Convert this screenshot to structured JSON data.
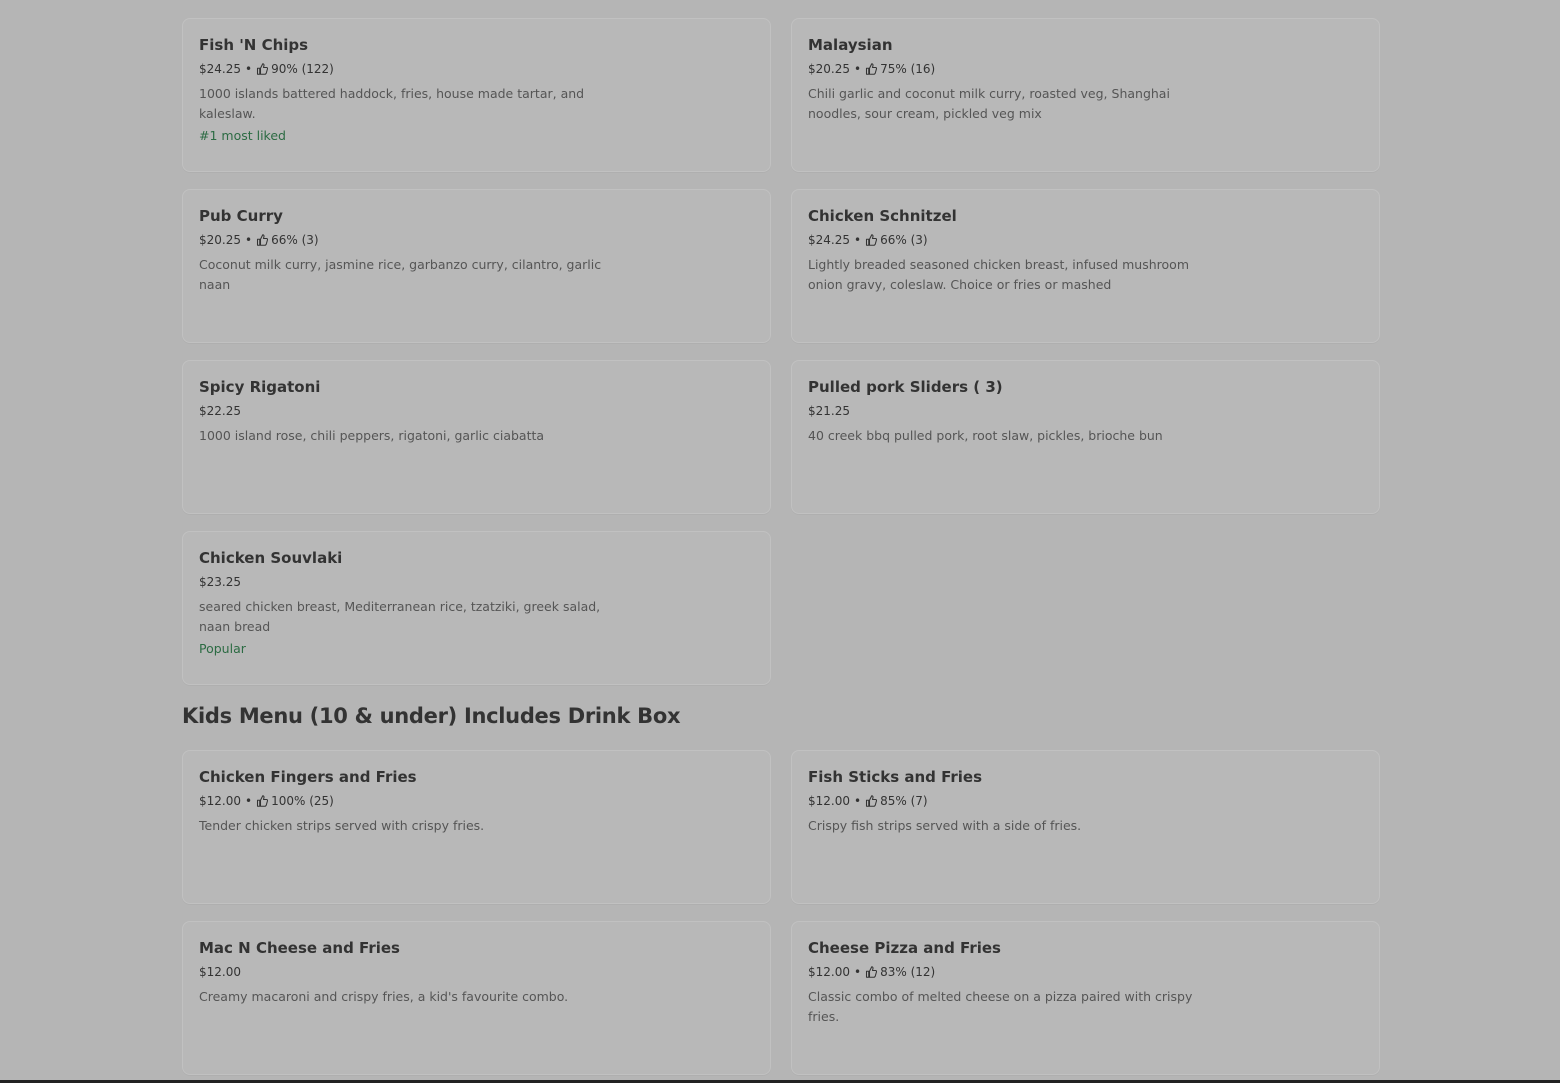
{
  "main_items": [
    {
      "name": "Fish 'N Chips",
      "price": "$24.25",
      "rating": "90% (122)",
      "description": "1000 islands battered haddock, fries, house made tartar, and kaleslaw.",
      "tag": "#1 most liked"
    },
    {
      "name": "Malaysian",
      "price": "$20.25",
      "rating": "75% (16)",
      "description": "Chili garlic and coconut milk curry, roasted veg, Shanghai noodles, sour cream, pickled veg mix",
      "tag": ""
    },
    {
      "name": "Pub Curry",
      "price": "$20.25",
      "rating": "66% (3)",
      "description": "Coconut milk curry, jasmine rice, garbanzo curry, cilantro, garlic naan",
      "tag": ""
    },
    {
      "name": "Chicken Schnitzel",
      "price": "$24.25",
      "rating": "66% (3)",
      "description": "Lightly breaded seasoned chicken breast, infused mushroom onion gravy, coleslaw. Choice or fries or mashed",
      "tag": ""
    },
    {
      "name": "Spicy Rigatoni",
      "price": "$22.25",
      "rating": "",
      "description": "1000 island rose, chili peppers, rigatoni, garlic ciabatta",
      "tag": ""
    },
    {
      "name": "Pulled pork Sliders ( 3)",
      "price": "$21.25",
      "rating": "",
      "description": "40 creek bbq pulled pork, root slaw, pickles, brioche bun",
      "tag": ""
    },
    {
      "name": "Chicken Souvlaki",
      "price": "$23.25",
      "rating": "",
      "description": "seared chicken breast, Mediterranean rice, tzatziki, greek salad, naan bread",
      "tag": "Popular"
    }
  ],
  "kids_section": {
    "title": "Kids Menu (10 & under) Includes Drink Box",
    "items": [
      {
        "name": "Chicken Fingers and Fries",
        "price": "$12.00",
        "rating": "100% (25)",
        "description": "Tender chicken strips served with crispy fries.",
        "tag": ""
      },
      {
        "name": "Fish Sticks and Fries",
        "price": "$12.00",
        "rating": "85% (7)",
        "description": "Crispy fish strips served with a side of fries.",
        "tag": ""
      },
      {
        "name": "Mac N Cheese  and Fries",
        "price": "$12.00",
        "rating": "",
        "description": "Creamy macaroni and crispy fries, a kid's favourite combo.",
        "tag": ""
      },
      {
        "name": "Cheese Pizza and Fries",
        "price": "$12.00",
        "rating": "83% (12)",
        "description": "Classic combo of melted cheese on a pizza paired with crispy fries.",
        "tag": ""
      }
    ]
  },
  "separator": "•",
  "colors": {
    "background": "#b5b5b5",
    "tag": "#2c6b43",
    "text": "#333333"
  },
  "icons": {
    "rating": "thumbs-up-icon"
  }
}
